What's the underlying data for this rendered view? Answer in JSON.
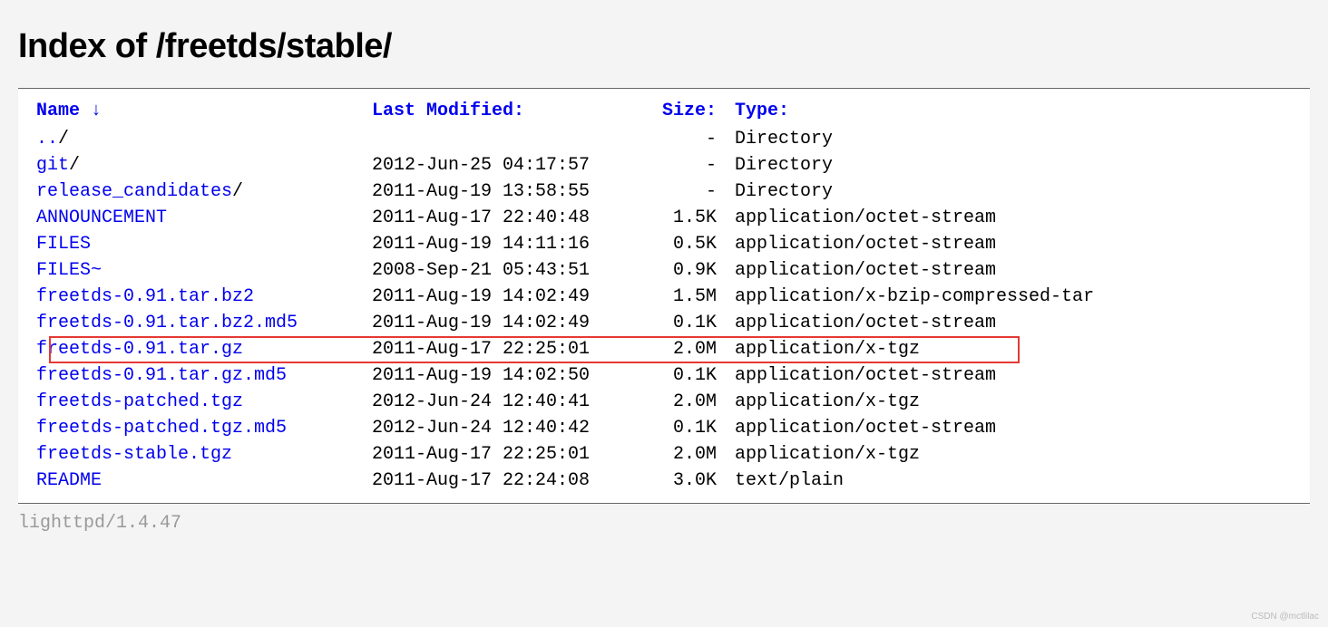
{
  "title": "Index of /freetds/stable/",
  "headers": {
    "name": "Name",
    "sort_arrow": "↓",
    "modified": "Last Modified:",
    "size": "Size:",
    "type": "Type:"
  },
  "rows": [
    {
      "name": "..",
      "suffix": "/",
      "modified": "",
      "size": "-",
      "type": "Directory",
      "highlighted": false
    },
    {
      "name": "git",
      "suffix": "/",
      "modified": "2012-Jun-25 04:17:57",
      "size": "-",
      "type": "Directory",
      "highlighted": false
    },
    {
      "name": "release_candidates",
      "suffix": "/",
      "modified": "2011-Aug-19 13:58:55",
      "size": "-",
      "type": "Directory",
      "highlighted": false
    },
    {
      "name": "ANNOUNCEMENT",
      "suffix": "",
      "modified": "2011-Aug-17 22:40:48",
      "size": "1.5K",
      "type": "application/octet-stream",
      "highlighted": false
    },
    {
      "name": "FILES",
      "suffix": "",
      "modified": "2011-Aug-19 14:11:16",
      "size": "0.5K",
      "type": "application/octet-stream",
      "highlighted": false
    },
    {
      "name": "FILES~",
      "suffix": "",
      "modified": "2008-Sep-21 05:43:51",
      "size": "0.9K",
      "type": "application/octet-stream",
      "highlighted": false
    },
    {
      "name": "freetds-0.91.tar.bz2",
      "suffix": "",
      "modified": "2011-Aug-19 14:02:49",
      "size": "1.5M",
      "type": "application/x-bzip-compressed-tar",
      "highlighted": false
    },
    {
      "name": "freetds-0.91.tar.bz2.md5",
      "suffix": "",
      "modified": "2011-Aug-19 14:02:49",
      "size": "0.1K",
      "type": "application/octet-stream",
      "highlighted": false
    },
    {
      "name": "freetds-0.91.tar.gz",
      "suffix": "",
      "modified": "2011-Aug-17 22:25:01",
      "size": "2.0M",
      "type": "application/x-tgz",
      "highlighted": true
    },
    {
      "name": "freetds-0.91.tar.gz.md5",
      "suffix": "",
      "modified": "2011-Aug-19 14:02:50",
      "size": "0.1K",
      "type": "application/octet-stream",
      "highlighted": false
    },
    {
      "name": "freetds-patched.tgz",
      "suffix": "",
      "modified": "2012-Jun-24 12:40:41",
      "size": "2.0M",
      "type": "application/x-tgz",
      "highlighted": false
    },
    {
      "name": "freetds-patched.tgz.md5",
      "suffix": "",
      "modified": "2012-Jun-24 12:40:42",
      "size": "0.1K",
      "type": "application/octet-stream",
      "highlighted": false
    },
    {
      "name": "freetds-stable.tgz",
      "suffix": "",
      "modified": "2011-Aug-17 22:25:01",
      "size": "2.0M",
      "type": "application/x-tgz",
      "highlighted": false
    },
    {
      "name": "README",
      "suffix": "",
      "modified": "2011-Aug-17 22:24:08",
      "size": "3.0K",
      "type": "text/plain",
      "highlighted": false
    }
  ],
  "footer": "lighttpd/1.4.47",
  "watermark": "CSDN @mctlilac"
}
